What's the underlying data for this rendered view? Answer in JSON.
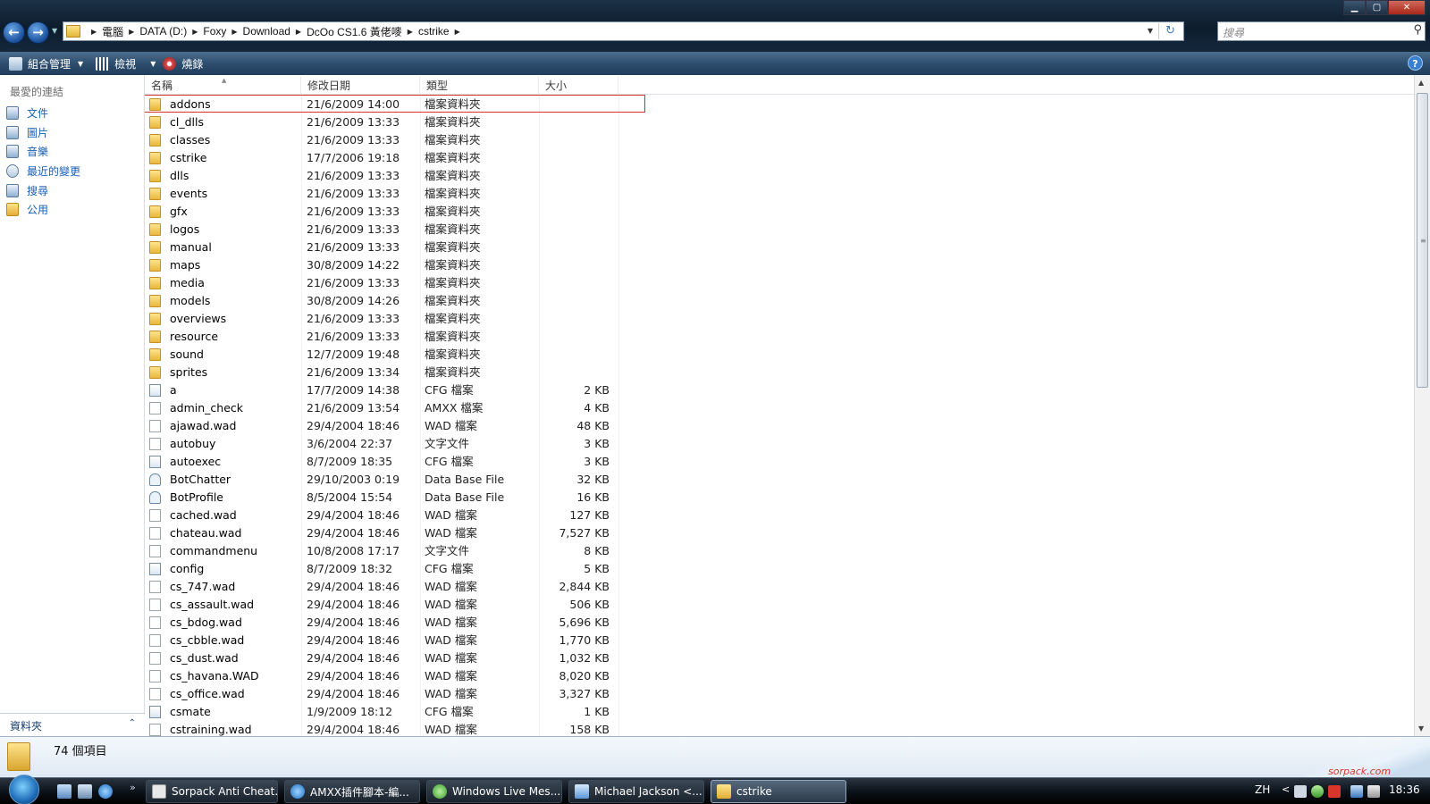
{
  "address_bar": {
    "crumbs": [
      "電腦",
      "DATA (D:)",
      "Foxy",
      "Download",
      "DcOo CS1.6 黃佬嘜",
      "cstrike"
    ],
    "search_placeholder": "搜尋"
  },
  "window_controls": {
    "minimize": "▁",
    "maximize": "▢",
    "close": "✕"
  },
  "toolbar": {
    "organize": "組合管理",
    "views": "檢視",
    "burn": "燒錄"
  },
  "nav_pane": {
    "title": "最愛的連結",
    "items": [
      {
        "label": "文件",
        "icon": "documents-icon"
      },
      {
        "label": "圖片",
        "icon": "pictures-icon"
      },
      {
        "label": "音樂",
        "icon": "music-icon"
      },
      {
        "label": "最近的變更",
        "icon": "recent-changes-icon"
      },
      {
        "label": "搜尋",
        "icon": "search-folder-icon"
      },
      {
        "label": "公用",
        "icon": "public-folder-icon"
      }
    ],
    "folders_label": "資料夾",
    "folders_chevron": "⌃"
  },
  "columns": {
    "name": "名稱",
    "date": "修改日期",
    "type": "類型",
    "size": "大小"
  },
  "files": [
    {
      "name": "addons",
      "date": "21/6/2009 14:00",
      "type": "檔案資料夾",
      "size": "",
      "kind": "folder"
    },
    {
      "name": "cl_dlls",
      "date": "21/6/2009 13:33",
      "type": "檔案資料夾",
      "size": "",
      "kind": "folder"
    },
    {
      "name": "classes",
      "date": "21/6/2009 13:33",
      "type": "檔案資料夾",
      "size": "",
      "kind": "folder"
    },
    {
      "name": "cstrike",
      "date": "17/7/2006 19:18",
      "type": "檔案資料夾",
      "size": "",
      "kind": "folder"
    },
    {
      "name": "dlls",
      "date": "21/6/2009 13:33",
      "type": "檔案資料夾",
      "size": "",
      "kind": "folder"
    },
    {
      "name": "events",
      "date": "21/6/2009 13:33",
      "type": "檔案資料夾",
      "size": "",
      "kind": "folder"
    },
    {
      "name": "gfx",
      "date": "21/6/2009 13:33",
      "type": "檔案資料夾",
      "size": "",
      "kind": "folder"
    },
    {
      "name": "logos",
      "date": "21/6/2009 13:33",
      "type": "檔案資料夾",
      "size": "",
      "kind": "folder"
    },
    {
      "name": "manual",
      "date": "21/6/2009 13:33",
      "type": "檔案資料夾",
      "size": "",
      "kind": "folder"
    },
    {
      "name": "maps",
      "date": "30/8/2009 14:22",
      "type": "檔案資料夾",
      "size": "",
      "kind": "folder"
    },
    {
      "name": "media",
      "date": "21/6/2009 13:33",
      "type": "檔案資料夾",
      "size": "",
      "kind": "folder"
    },
    {
      "name": "models",
      "date": "30/8/2009 14:26",
      "type": "檔案資料夾",
      "size": "",
      "kind": "folder"
    },
    {
      "name": "overviews",
      "date": "21/6/2009 13:33",
      "type": "檔案資料夾",
      "size": "",
      "kind": "folder"
    },
    {
      "name": "resource",
      "date": "21/6/2009 13:33",
      "type": "檔案資料夾",
      "size": "",
      "kind": "folder"
    },
    {
      "name": "sound",
      "date": "12/7/2009 19:48",
      "type": "檔案資料夾",
      "size": "",
      "kind": "folder"
    },
    {
      "name": "sprites",
      "date": "21/6/2009 13:34",
      "type": "檔案資料夾",
      "size": "",
      "kind": "folder"
    },
    {
      "name": "a",
      "date": "17/7/2009 14:38",
      "type": "CFG 檔案",
      "size": "2 KB",
      "kind": "cfg"
    },
    {
      "name": "admin_check",
      "date": "21/6/2009 13:54",
      "type": "AMXX 檔案",
      "size": "4 KB",
      "kind": "file"
    },
    {
      "name": "ajawad.wad",
      "date": "29/4/2004 18:46",
      "type": "WAD 檔案",
      "size": "48 KB",
      "kind": "file"
    },
    {
      "name": "autobuy",
      "date": "3/6/2004 22:37",
      "type": "文字文件",
      "size": "3 KB",
      "kind": "file"
    },
    {
      "name": "autoexec",
      "date": "8/7/2009 18:35",
      "type": "CFG 檔案",
      "size": "3 KB",
      "kind": "cfg"
    },
    {
      "name": "BotChatter",
      "date": "29/10/2003 0:19",
      "type": "Data Base File",
      "size": "32 KB",
      "kind": "db"
    },
    {
      "name": "BotProfile",
      "date": "8/5/2004 15:54",
      "type": "Data Base File",
      "size": "16 KB",
      "kind": "db"
    },
    {
      "name": "cached.wad",
      "date": "29/4/2004 18:46",
      "type": "WAD 檔案",
      "size": "127 KB",
      "kind": "file"
    },
    {
      "name": "chateau.wad",
      "date": "29/4/2004 18:46",
      "type": "WAD 檔案",
      "size": "7,527 KB",
      "kind": "file"
    },
    {
      "name": "commandmenu",
      "date": "10/8/2008 17:17",
      "type": "文字文件",
      "size": "8 KB",
      "kind": "file"
    },
    {
      "name": "config",
      "date": "8/7/2009 18:32",
      "type": "CFG 檔案",
      "size": "5 KB",
      "kind": "cfg"
    },
    {
      "name": "cs_747.wad",
      "date": "29/4/2004 18:46",
      "type": "WAD 檔案",
      "size": "2,844 KB",
      "kind": "file"
    },
    {
      "name": "cs_assault.wad",
      "date": "29/4/2004 18:46",
      "type": "WAD 檔案",
      "size": "506 KB",
      "kind": "file"
    },
    {
      "name": "cs_bdog.wad",
      "date": "29/4/2004 18:46",
      "type": "WAD 檔案",
      "size": "5,696 KB",
      "kind": "file"
    },
    {
      "name": "cs_cbble.wad",
      "date": "29/4/2004 18:46",
      "type": "WAD 檔案",
      "size": "1,770 KB",
      "kind": "file"
    },
    {
      "name": "cs_dust.wad",
      "date": "29/4/2004 18:46",
      "type": "WAD 檔案",
      "size": "1,032 KB",
      "kind": "file"
    },
    {
      "name": "cs_havana.WAD",
      "date": "29/4/2004 18:46",
      "type": "WAD 檔案",
      "size": "8,020 KB",
      "kind": "file"
    },
    {
      "name": "cs_office.wad",
      "date": "29/4/2004 18:46",
      "type": "WAD 檔案",
      "size": "3,327 KB",
      "kind": "file"
    },
    {
      "name": "csmate",
      "date": "1/9/2009 18:12",
      "type": "CFG 檔案",
      "size": "1 KB",
      "kind": "cfg"
    },
    {
      "name": "cstraining.wad",
      "date": "29/4/2004 18:46",
      "type": "WAD 檔案",
      "size": "158 KB",
      "kind": "file"
    }
  ],
  "details": {
    "count": "74 個項目"
  },
  "taskbar": {
    "tasks": [
      {
        "label": "Sorpack Anti Cheat...",
        "active": false
      },
      {
        "label": "AMXX插件腳本-編...",
        "active": false
      },
      {
        "label": "Windows Live Mes...",
        "active": false
      },
      {
        "label": "Michael Jackson <...",
        "active": false
      },
      {
        "label": "cstrike",
        "active": true
      }
    ],
    "quicklaunch_more": "»",
    "language": "ZH",
    "tray_chevron": "<",
    "clock": "18:36",
    "watermark": "sorpack.com"
  },
  "colors": {
    "highlight_border": "#d6332a",
    "link_blue": "#1a5fb4"
  }
}
